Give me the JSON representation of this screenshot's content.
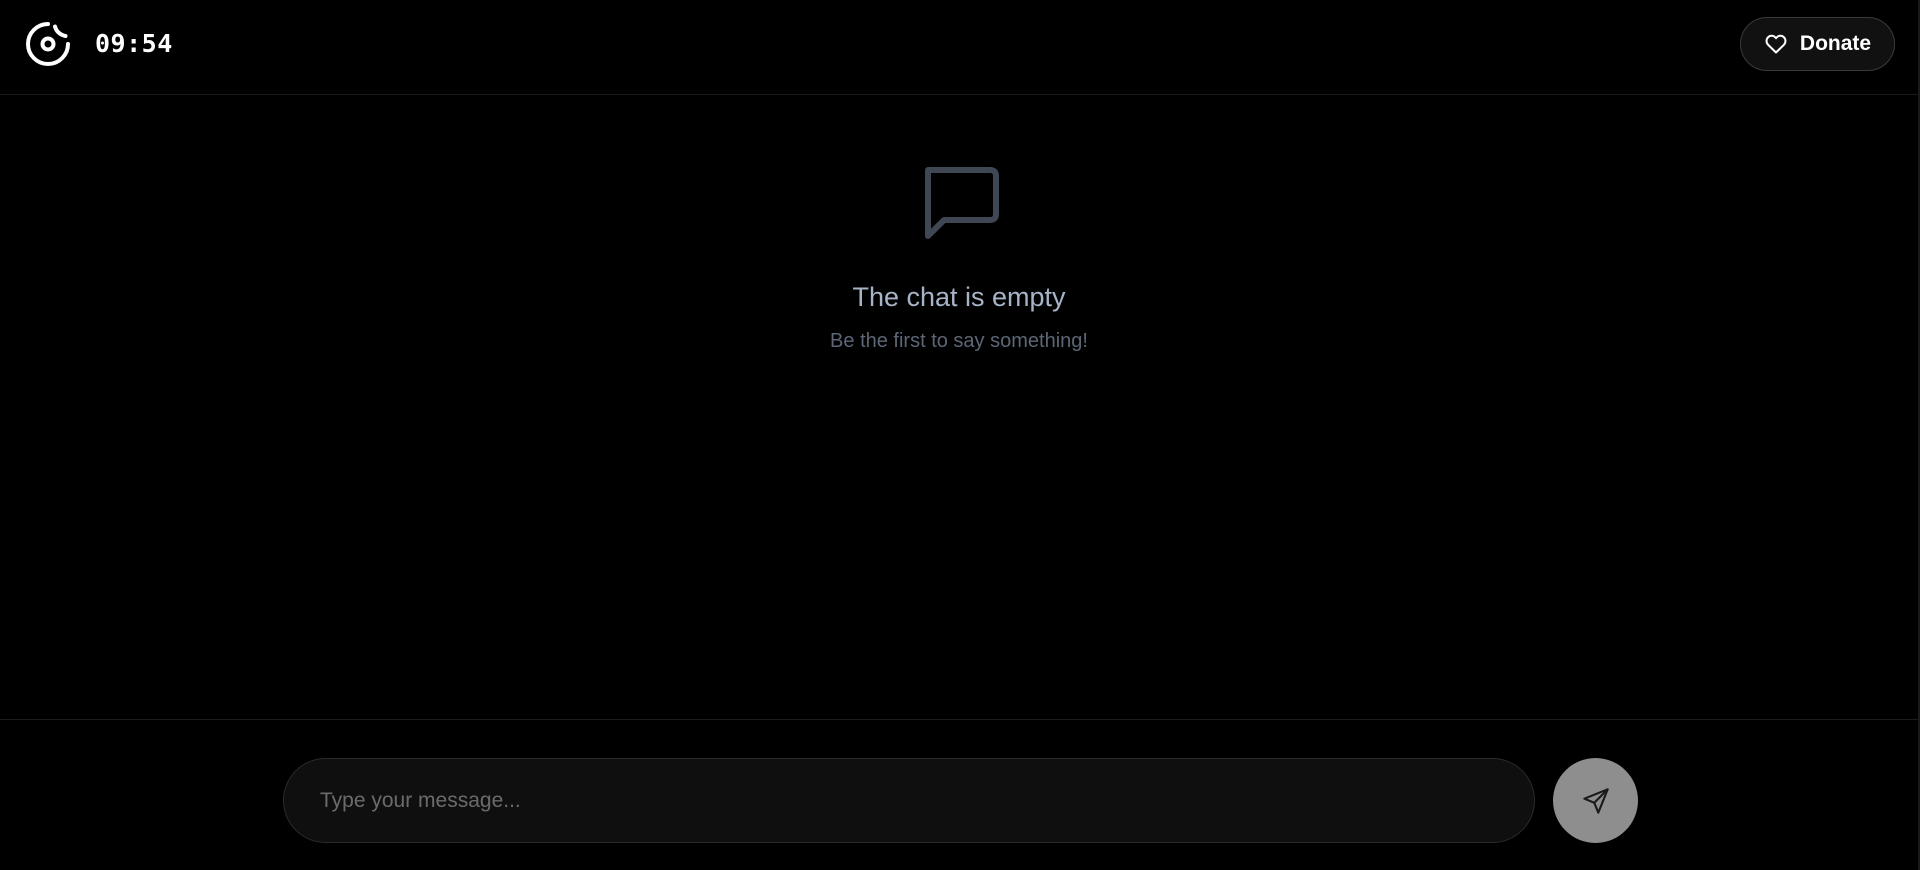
{
  "header": {
    "logo_icon": "timer-logo-icon",
    "timer": "09:54",
    "donate": {
      "icon": "heart-icon",
      "label": "Donate"
    }
  },
  "empty_state": {
    "icon": "chat-bubble-icon",
    "title": "The chat is empty",
    "subtitle": "Be the first to say something!"
  },
  "composer": {
    "placeholder": "Type your message...",
    "value": "",
    "send_icon": "send-icon"
  },
  "colors": {
    "background": "#000000",
    "title_text": "#a7b4c8",
    "subtitle_text": "#5c6676",
    "icon_muted": "#3f4654",
    "send_button": "#8e8e8e"
  }
}
